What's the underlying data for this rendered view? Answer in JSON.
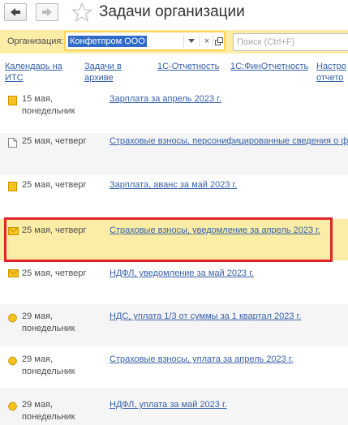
{
  "window": {
    "title": "Задачи организации"
  },
  "toolbar": {
    "back_icon": "arrow-left-icon",
    "forward_icon": "arrow-right-icon",
    "favorite_icon": "star-icon"
  },
  "org": {
    "label": "Организация:",
    "value": "Конфетпром ООО",
    "search_placeholder": "Поиск (Ctrl+F)"
  },
  "links": [
    "Календарь на\nИТС",
    "Задачи в\nархиве",
    "1С-Отчетность",
    "1С:ФинОтчетность",
    "Настро\nотчето"
  ],
  "tasks": [
    {
      "date": "15 мая,\nпонедельник",
      "title": "Зарплата за апрель 2023 г.",
      "icon": "salary-doc-icon"
    },
    {
      "date": "25 мая, четверг",
      "title": "Страховые взносы, персонифицированные сведения о ф",
      "icon": "document-icon"
    },
    {
      "date": "25 мая, четверг",
      "title": "Зарплата, аванс за май 2023 г.",
      "icon": "salary-doc-icon"
    },
    {
      "date": "25 мая, четверг",
      "title": "Страховые взносы, уведомление за апрель 2023 г.",
      "icon": "envelope-icon",
      "selected": true
    },
    {
      "date": "25 мая, четверг",
      "title": "НДФЛ, уведомление за май 2023 г.",
      "icon": "envelope-icon"
    },
    {
      "date": "29 мая,\nпонедельник",
      "title": "НДС, уплата 1/3 от суммы за 1 квартал 2023 г.",
      "icon": "coin-icon"
    },
    {
      "date": "29 мая,\nпонедельник",
      "title": "Страховые взносы, уплата за апрель 2023 г.",
      "icon": "coin-icon"
    },
    {
      "date": "29 мая,\nпонедельник",
      "title": "НДФЛ, уплата за май 2023 г.",
      "icon": "coin-icon"
    }
  ],
  "colors": {
    "accent": "#fbeca6",
    "link": "#3760a8",
    "selection_border": "#e2232a"
  }
}
